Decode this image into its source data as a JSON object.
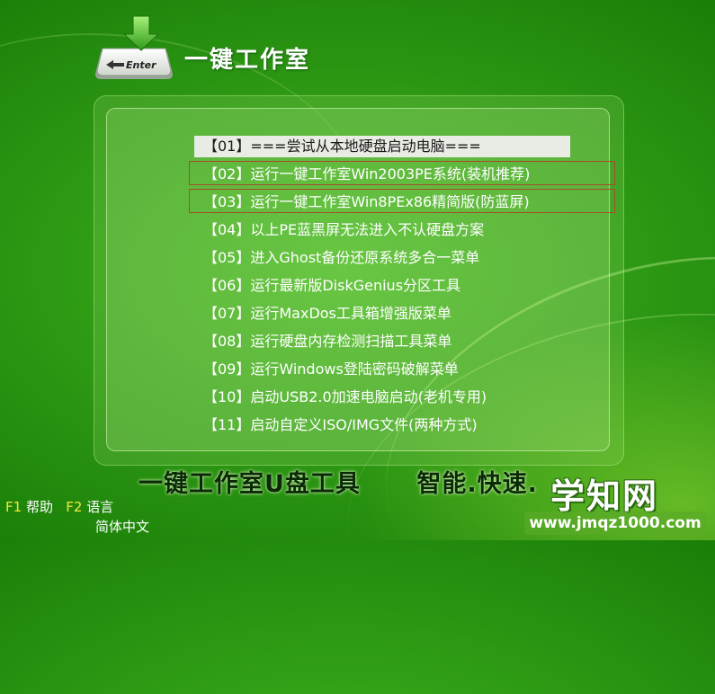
{
  "header": {
    "logo_key_label": "Enter",
    "app_title": "一键工作室"
  },
  "menu": {
    "items": [
      {
        "label": "【01】===尝试从本地硬盘启动电脑===",
        "selected": true
      },
      {
        "label": "【02】运行一键工作室Win2003PE系统(装机推荐)",
        "boxed": true
      },
      {
        "label": "【03】运行一键工作室Win8PEx86精简版(防蓝屏)",
        "boxed": true
      },
      {
        "label": "【04】以上PE蓝黑屏无法进入不认硬盘方案"
      },
      {
        "label": "【05】进入Ghost备份还原系统多合一菜单"
      },
      {
        "label": "【06】运行最新版DiskGenius分区工具"
      },
      {
        "label": "【07】运行MaxDos工具箱增强版菜单"
      },
      {
        "label": "【08】运行硬盘内存检测扫描工具菜单"
      },
      {
        "label": "【09】运行Windows登陆密码破解菜单"
      },
      {
        "label": "【10】启动USB2.0加速电脑启动(老机专用)"
      },
      {
        "label": "【11】启动自定义ISO/IMG文件(两种方式)"
      }
    ]
  },
  "slogan": "一键工作室U盘工具      智能.快速.",
  "footer": {
    "f1_key": "F1",
    "f1_label": "帮助",
    "f2_key": "F2",
    "f2_label": "语言",
    "language_value": "简体中文"
  },
  "watermark": {
    "title": "学知网",
    "url": "www.jmqz1000.com"
  },
  "colors": {
    "background": "#2a9412",
    "selected_row": "#e9ece4",
    "box_border": "#a84a2c",
    "fkey": "#f5e83a"
  }
}
